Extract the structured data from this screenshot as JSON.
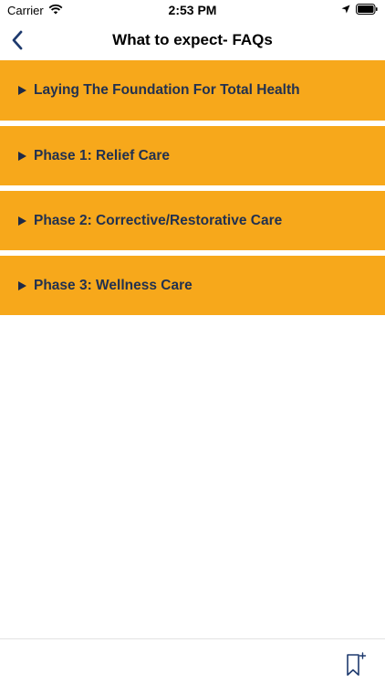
{
  "status_bar": {
    "carrier": "Carrier",
    "time": "2:53 PM",
    "icons": [
      "wifi-icon",
      "location-icon",
      "battery-icon"
    ]
  },
  "nav": {
    "title": "What to expect- FAQs",
    "back_icon": "chevron-left-icon"
  },
  "faq": {
    "items": [
      {
        "label": "Laying The Foundation For Total Health"
      },
      {
        "label": "Phase 1: Relief Care"
      },
      {
        "label": "Phase 2: Corrective/Restorative Care"
      },
      {
        "label": "Phase 3: Wellness Care"
      }
    ]
  },
  "toolbar": {
    "bookmark_icon": "bookmark-add-icon"
  },
  "colors": {
    "accent": "#f7a81b",
    "text_dark": "#22314f",
    "nav_icon": "#1e3a6e"
  }
}
